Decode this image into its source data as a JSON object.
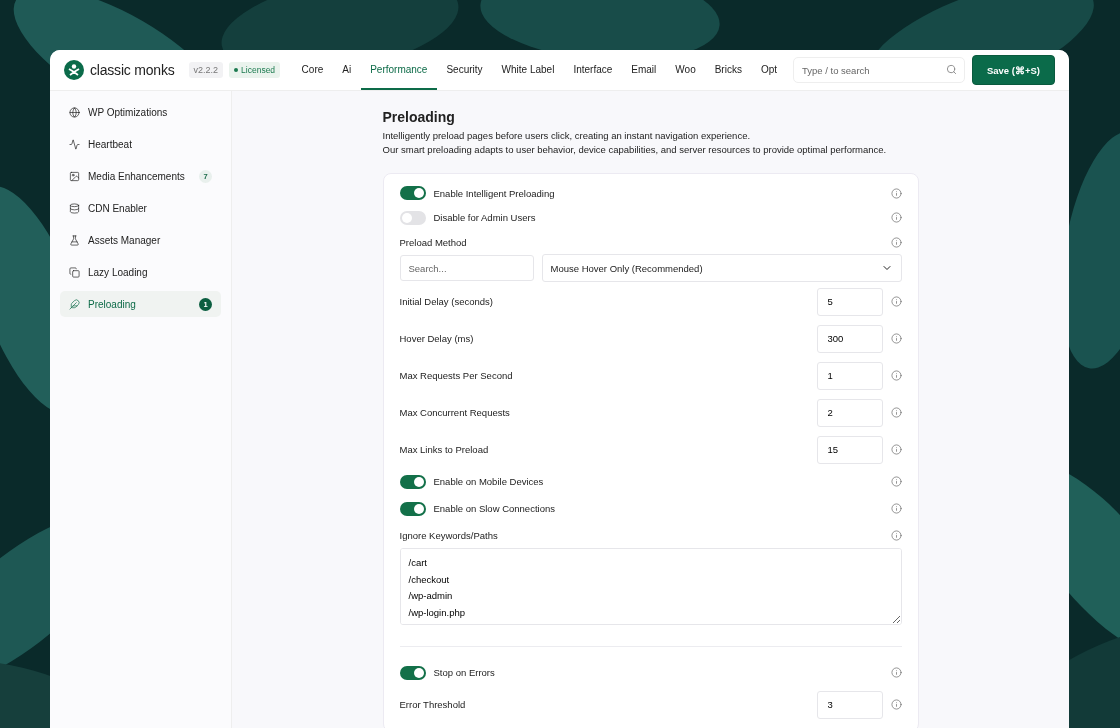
{
  "header": {
    "brand": "classic monks",
    "version": "v2.2.2",
    "license": "Licensed",
    "tabs": [
      {
        "label": "Core",
        "selected": false
      },
      {
        "label": "Ai",
        "selected": false
      },
      {
        "label": "Performance",
        "selected": true
      },
      {
        "label": "Security",
        "selected": false
      },
      {
        "label": "White Label",
        "selected": false
      },
      {
        "label": "Interface",
        "selected": false
      },
      {
        "label": "Email",
        "selected": false
      },
      {
        "label": "Woo",
        "selected": false
      },
      {
        "label": "Bricks",
        "selected": false
      },
      {
        "label": "Opt",
        "selected": false
      }
    ],
    "search": {
      "placeholder": "Type / to search"
    },
    "save_button": "Save (⌘+S)"
  },
  "sidebar": {
    "items": [
      {
        "label": "WP Optimizations",
        "selected": false
      },
      {
        "label": "Heartbeat",
        "selected": false
      },
      {
        "label": "Media Enhancements",
        "badge": "7",
        "selected": false
      },
      {
        "label": "CDN Enabler",
        "selected": false
      },
      {
        "label": "Assets Manager",
        "selected": false
      },
      {
        "label": "Lazy Loading",
        "selected": false
      },
      {
        "label": "Preloading",
        "badge": "1",
        "selected": true
      }
    ]
  },
  "section": {
    "title": "Preloading",
    "description": [
      "Intelligently preload pages before users click, creating an instant navigation experience.",
      "Our smart preloading adapts to user behavior, device capabilities, and server resources to provide optimal performance."
    ]
  },
  "settings": [
    {
      "kind": "toggle",
      "label": "Enable Intelligent Preloading",
      "on": true
    },
    {
      "kind": "toggle",
      "label": "Disable for Admin Users",
      "on": false
    },
    {
      "kind": "select",
      "label": "Preload Method",
      "search_placeholder": "Search...",
      "value": "Mouse Hover Only (Recommended)"
    },
    {
      "kind": "number",
      "label": "Initial Delay (seconds)",
      "value": "5"
    },
    {
      "kind": "number",
      "label": "Hover Delay (ms)",
      "value": "300"
    },
    {
      "kind": "number",
      "label": "Max Requests Per Second",
      "value": "1"
    },
    {
      "kind": "number",
      "label": "Max Concurrent Requests",
      "value": "2"
    },
    {
      "kind": "number",
      "label": "Max Links to Preload",
      "value": "15"
    },
    {
      "kind": "toggle",
      "label": "Enable on Mobile Devices",
      "on": true
    },
    {
      "kind": "toggle",
      "label": "Enable on Slow Connections",
      "on": true
    },
    {
      "kind": "textarea",
      "label": "Ignore Keywords/Paths",
      "value": "/cart\n/checkout\n/wp-admin\n/wp-login.php"
    },
    {
      "kind": "divider"
    },
    {
      "kind": "toggle",
      "label": "Stop on Errors",
      "on": true
    },
    {
      "kind": "number",
      "label": "Error Threshold",
      "value": "3"
    }
  ]
}
